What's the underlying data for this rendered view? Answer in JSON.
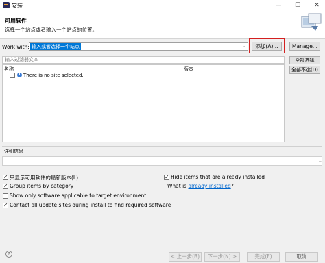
{
  "window": {
    "title": "安装",
    "minimize": "—",
    "maximize": "☐",
    "close": "✕"
  },
  "banner": {
    "title": "可用软件",
    "subtitle": "选择一个站点或者输入一个站点的位置。"
  },
  "work_with": {
    "label": "Work with:",
    "value": "输入或者选择一个站点",
    "add_button": "添加(A)...",
    "manage_button": "Manage..."
  },
  "filter": {
    "placeholder": "输入过滤器文本"
  },
  "table": {
    "columns": [
      "名称",
      "版本"
    ],
    "rows": [
      {
        "name": "There is no site selected.",
        "checked": false
      }
    ]
  },
  "side_buttons": {
    "select_all": "全部选择",
    "deselect_all": "全部不选(D)"
  },
  "details": {
    "label": "详细信息"
  },
  "options": {
    "show_latest": "只显示可用软件的最新版本(L)",
    "group_by_category": "Group items by category",
    "show_applicable": "Show only software applicable to target environment",
    "contact_sites": "Contact all update sites during install to find required software",
    "hide_installed": "Hide items that are already installed",
    "what_is_prefix": "What is",
    "what_is_link": "already installed",
    "what_is_suffix": "?"
  },
  "nav": {
    "back": "< 上一步(B)",
    "next": "下一步(N) >",
    "finish": "完成(F)",
    "cancel": "取消"
  },
  "icons": {
    "help": "?"
  }
}
